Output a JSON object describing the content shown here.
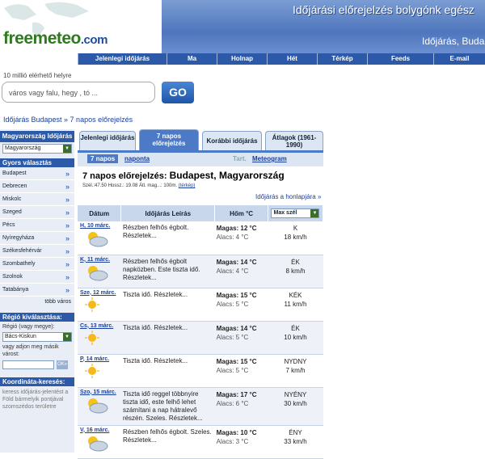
{
  "logo": {
    "free": "free",
    "meteo": "meteo",
    "dot": ".com"
  },
  "banner": {
    "slogan": "Időjárási előrejelzés bolygónk egész",
    "sub": "Időjárás, Budap"
  },
  "topnav": [
    "Jelenlegi időjárás",
    "Ma",
    "Holnap",
    "Hét",
    "Térkép",
    "Feeds",
    "E-mail"
  ],
  "search": {
    "tagline": "10 millió elérhető helyre",
    "placeholder": "város vagy falu, hegy , tó ...",
    "go": "GO"
  },
  "breadcrumb": "Időjárás Budapest » 7 napos előrejelzés",
  "sidebar": {
    "country_head": "Magyarország Időjárás",
    "country_select": "Magyarország",
    "quick_title": "Gyors választás",
    "cities": [
      "Budapest",
      "Debrecen",
      "Miskolc",
      "Szeged",
      "Pécs",
      "Nyíregyháza",
      "Székesfehérvár",
      "Szombathely",
      "Szolnok",
      "Tatabánya"
    ],
    "more": "több város",
    "region_title": "Régió kiválasztása:",
    "region_label": "Régió (vagy megye):",
    "region_select": "Bács-Kiskun",
    "other_label": "vagy adjon meg másik várost:",
    "ok": "OK»",
    "coord_title": "Koordináta-keresés:",
    "coord_text": "keress időjárás-jelentést a Föld bármelyik pontjával szomszédos területre"
  },
  "tabs": [
    {
      "label": "Jelenlegi időjárás",
      "active": false
    },
    {
      "label": "7 napos előrejelzés",
      "active": true
    },
    {
      "label": "Korábbi időjárás",
      "active": false
    },
    {
      "label": "Átlagok (1961-1990)",
      "active": false
    }
  ],
  "subtabs": {
    "a": "7 napos",
    "b": "naponta",
    "c": "Tart.",
    "d": "Meteogram"
  },
  "heading": {
    "prefix": "7 napos előrejelzés: ",
    "city": "Budapest, Magyarország"
  },
  "coords": {
    "text": "Szél.:47.50 Hossz.: 19.08 Átl. mag...: 100m.",
    "link": "(térkép)"
  },
  "home_link": "Időjárás a honlapjára »",
  "table_head": {
    "date": "Dátum",
    "desc": "Időjárás Leírás",
    "temp": "Hőm °C",
    "wind": "Max szél"
  },
  "days": [
    {
      "date": "H, 10 márc.",
      "icon": "partly-cloudy-icon",
      "desc": "Részben felhős égbolt. Részletek...",
      "max": "Magas: 12 °C",
      "min": "Alacs: 4 °C",
      "wdir": "K",
      "wspeed": "18 km/h"
    },
    {
      "date": "K, 11 márc.",
      "icon": "partly-cloudy-icon",
      "desc": "Részben felhős égbolt napközben. Este tiszta idő. Részletek...",
      "max": "Magas: 14 °C",
      "min": "Alacs: 4 °C",
      "wdir": "ÉK",
      "wspeed": "8 km/h"
    },
    {
      "date": "Sze, 12 márc.",
      "icon": "sun-icon",
      "desc": "Tiszta idő. Részletek...",
      "max": "Magas: 15 °C",
      "min": "Alacs: 5 °C",
      "wdir": "KÉK",
      "wspeed": "11 km/h"
    },
    {
      "date": "Cs, 13 márc.",
      "icon": "sun-icon",
      "desc": "Tiszta idő. Részletek...",
      "max": "Magas: 14 °C",
      "min": "Alacs: 5 °C",
      "wdir": "ÉK",
      "wspeed": "10 km/h"
    },
    {
      "date": "P, 14 márc.",
      "icon": "sun-icon",
      "desc": "Tiszta idő. Részletek...",
      "max": "Magas: 15 °C",
      "min": "Alacs: 5 °C",
      "wdir": "NYDNY",
      "wspeed": "7 km/h"
    },
    {
      "date": "Szo, 15 márc.",
      "icon": "partly-cloudy-icon",
      "desc": "Tiszta idő reggel többnyire tiszta idő, este felhő lehet számítani a nap hátralevő részén. Szeles. Részletek...",
      "max": "Magas: 17 °C",
      "min": "Alacs: 6 °C",
      "wdir": "NYÉNY",
      "wspeed": "30 km/h"
    },
    {
      "date": "V, 16 márc.",
      "icon": "partly-cloudy-icon",
      "desc": "Részben felhős égbolt. Szeles. Részletek...",
      "max": "Magas: 10 °C",
      "min": "Alacs: 3 °C",
      "wdir": "ÉNY",
      "wspeed": "33 km/h"
    }
  ]
}
